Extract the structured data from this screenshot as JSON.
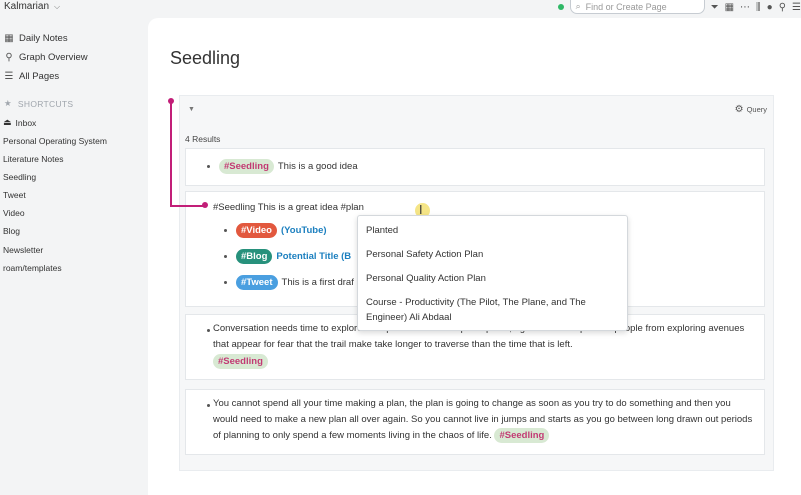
{
  "sidebar": {
    "graph_name": "Kalmarian",
    "nav": [
      {
        "label": "Daily Notes",
        "icon": "calendar-icon"
      },
      {
        "label": "Graph Overview",
        "icon": "graph-icon"
      },
      {
        "label": "All Pages",
        "icon": "list-icon"
      }
    ],
    "shortcuts_label": "SHORTCUTS",
    "shortcuts": [
      "Inbox",
      "Personal Operating System",
      "Literature Notes",
      "Seedling",
      "Tweet",
      "Video",
      "Blog",
      "Newsletter",
      "roam/templates"
    ]
  },
  "topbar": {
    "search_placeholder": "Find or Create Page"
  },
  "page": {
    "title": "Seedling",
    "query_label": "Query",
    "results": "4 Results"
  },
  "blocks": {
    "b1_tag": "#Seedling",
    "b1_text": "This is a good idea",
    "b2_text": "#Seedling This is a great idea #plan",
    "b2_video_tag": "#Video",
    "b2_video_link": "(YouTube)",
    "b2_blog_tag": "#Blog",
    "b2_blog_link": "Potential Title (B",
    "b2_tweet_tag": "#Tweet",
    "b2_tweet_text": "This is a first draf",
    "b3_text": "Conversation needs time to explore the open terrain of the participants, rigid time limits prevent people from exploring avenues that appear for fear that the trail make take longer to traverse than the time that is left.",
    "b3_tag": "#Seedling",
    "b4_text": "You cannot spend all your time making a plan, the plan is going to change as soon as you try to do something and then you would need to make a new plan all over again. So you cannot live in jumps and starts as you go between long drawn out periods of planning to only spend a few moments living in the chaos of life.",
    "b4_tag": "#Seedling"
  },
  "autocomplete": {
    "items": [
      "Planted",
      "Personal Safety Action Plan",
      "Personal Quality Action Plan",
      "Course - Productivity (The Pilot, The Plane, and The Engineer) Ali Abdaal"
    ]
  }
}
